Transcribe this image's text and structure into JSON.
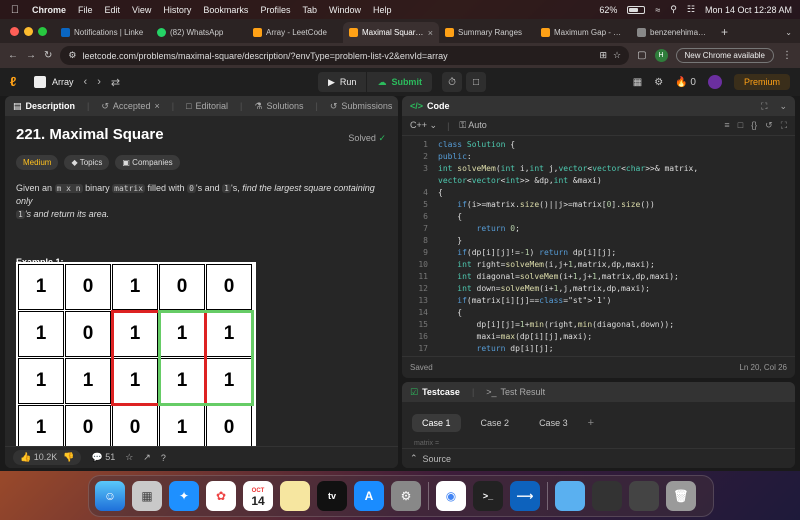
{
  "menubar": {
    "app_name": "Chrome",
    "menus": [
      "File",
      "Edit",
      "View",
      "History",
      "Bookmarks",
      "Profiles",
      "Tab",
      "Window",
      "Help"
    ],
    "battery": "62%",
    "datetime": "Mon 14 Oct  12:28 AM"
  },
  "tabs": [
    {
      "label": "Notifications | Linke",
      "color": "#0a66c2"
    },
    {
      "label": "(82) WhatsApp",
      "color": "#25d366"
    },
    {
      "label": "Array - LeetCode",
      "color": "#ffa116"
    },
    {
      "label": "Maximal Square - Le",
      "color": "#ffa116"
    },
    {
      "label": "Summary Ranges",
      "color": "#ffa116"
    },
    {
      "label": "Maximum Gap - Leet",
      "color": "#ffa116"
    },
    {
      "label": "benzenehimanshu",
      "color": "#888888"
    }
  ],
  "address": {
    "url": "leetcode.com/problems/maximal-square/description/?envType=problem-list-v2&envId=array",
    "profile_initial": "H",
    "update_label": "New Chrome available"
  },
  "lc_header": {
    "list_title": "Array",
    "run_label": "Run",
    "submit_label": "Submit",
    "streak": "0",
    "premium_label": "Premium"
  },
  "left_tabs": {
    "description": "Description",
    "accepted": "Accepted",
    "editorial": "Editorial",
    "solutions": "Solutions",
    "submissions": "Submissions"
  },
  "problem": {
    "title": "221. Maximal Square",
    "status": "Solved",
    "difficulty": "Medium",
    "topics_label": "Topics",
    "companies_label": "Companies",
    "desc_1": "Given an ",
    "desc_mxn": "m x n",
    "desc_2": " binary ",
    "desc_matrix": "matrix",
    "desc_3": " filled with ",
    "desc_0": "0",
    "desc_4": "'s and ",
    "desc_1b": "1",
    "desc_5": "'s, ",
    "desc_italic": "find the largest square containing only",
    "desc_1c": "1",
    "desc_italic2": "'s and return its area.",
    "example_title": "Example 1:",
    "grid": [
      [
        "1",
        "0",
        "1",
        "0",
        "0"
      ],
      [
        "1",
        "0",
        "1",
        "1",
        "1"
      ],
      [
        "1",
        "1",
        "1",
        "1",
        "1"
      ],
      [
        "1",
        "0",
        "0",
        "1",
        "0"
      ]
    ]
  },
  "left_footer": {
    "likes": "10.2K",
    "comments": "51"
  },
  "code_panel": {
    "title": "Code",
    "language": "C++",
    "mode": "Auto",
    "status": "Saved",
    "position": "Ln 20, Col 26",
    "lines": [
      {
        "n": "1",
        "t": "class Solution {"
      },
      {
        "n": "2",
        "t": "public:"
      },
      {
        "n": "3",
        "t": "int solveMem(int i,int j,vector<vector<char>>& matrix,"
      },
      {
        "n": "",
        "t": "vector<vector<int>> &dp,int &maxi)"
      },
      {
        "n": "4",
        "t": "{"
      },
      {
        "n": "5",
        "t": "    if(i>=matrix.size()||j>=matrix[0].size())"
      },
      {
        "n": "6",
        "t": "    {"
      },
      {
        "n": "7",
        "t": "        return 0;"
      },
      {
        "n": "8",
        "t": "    }"
      },
      {
        "n": "9",
        "t": "    if(dp[i][j]!=-1) return dp[i][j];"
      },
      {
        "n": "10",
        "t": "    int right=solveMem(i,j+1,matrix,dp,maxi);"
      },
      {
        "n": "11",
        "t": "    int diagonal=solveMem(i+1,j+1,matrix,dp,maxi);"
      },
      {
        "n": "12",
        "t": "    int down=solveMem(i+1,j,matrix,dp,maxi);"
      },
      {
        "n": "13",
        "t": "    if(matrix[i][j]=='1')"
      },
      {
        "n": "14",
        "t": "    {"
      },
      {
        "n": "15",
        "t": "        dp[i][j]=1+min(right,min(diagonal,down));"
      },
      {
        "n": "16",
        "t": "        maxi=max(dp[i][j],maxi);"
      },
      {
        "n": "17",
        "t": "        return dp[i][j];"
      }
    ]
  },
  "test_panel": {
    "testcase": "Testcase",
    "result": "Test Result",
    "cases": [
      "Case 1",
      "Case 2",
      "Case 3"
    ],
    "faint": "matrix =",
    "source": "Source"
  },
  "dock": {
    "calendar_month": "OCT",
    "calendar_day": "14",
    "tv_label": "tv"
  }
}
